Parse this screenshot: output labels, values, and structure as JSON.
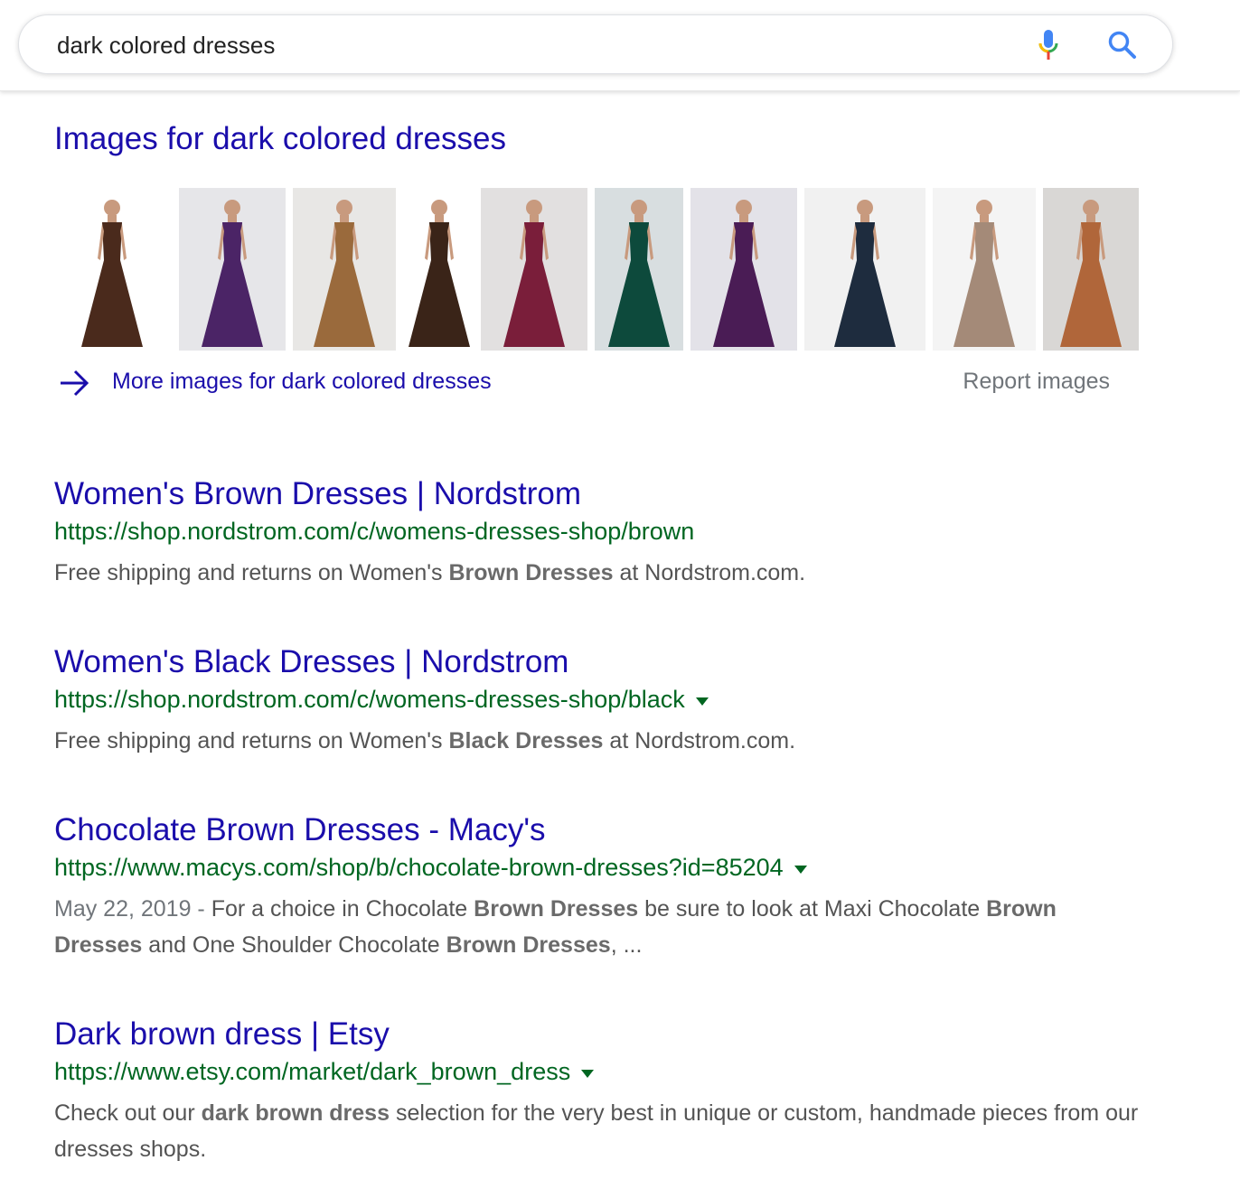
{
  "search": {
    "query": "dark colored dresses",
    "mic_icon": "mic-icon",
    "search_icon": "search-icon"
  },
  "images_block": {
    "heading": "Images for dark colored dresses",
    "thumbnails": [
      {
        "name": "brown halter gown",
        "dress_color": "#4a2a1c"
      },
      {
        "name": "purple ball gown",
        "dress_color": "#4b2466"
      },
      {
        "name": "bronze satin gown",
        "dress_color": "#9a6a3c"
      },
      {
        "name": "dark brown draped gown",
        "dress_color": "#3a2418"
      },
      {
        "name": "burgundy gown",
        "dress_color": "#7a1e3a"
      },
      {
        "name": "emerald slit gown",
        "dress_color": "#0d4a3c"
      },
      {
        "name": "purple satin gown",
        "dress_color": "#4a1c55"
      },
      {
        "name": "navy short dress",
        "dress_color": "#1e2c3e"
      },
      {
        "name": "taupe mermaid gown",
        "dress_color": "#a48a78"
      },
      {
        "name": "rust printed gown",
        "dress_color": "#b0663a"
      }
    ],
    "more_link": "More images for dark colored dresses",
    "report_link": "Report images"
  },
  "results": [
    {
      "title": "Women's Brown Dresses | Nordstrom",
      "url": "https://shop.nordstrom.com/c/womens-dresses-shop/brown",
      "has_caret": false,
      "date": "",
      "snippet_parts": [
        {
          "text": "Free shipping and returns on Women's ",
          "bold": false
        },
        {
          "text": "Brown Dresses",
          "bold": true
        },
        {
          "text": " at Nordstrom.com.",
          "bold": false
        }
      ]
    },
    {
      "title": "Women's Black Dresses | Nordstrom",
      "url": "https://shop.nordstrom.com/c/womens-dresses-shop/black",
      "has_caret": true,
      "date": "",
      "snippet_parts": [
        {
          "text": "Free shipping and returns on Women's ",
          "bold": false
        },
        {
          "text": "Black Dresses",
          "bold": true
        },
        {
          "text": " at Nordstrom.com.",
          "bold": false
        }
      ]
    },
    {
      "title": "Chocolate Brown Dresses - Macy's",
      "url": "https://www.macys.com/shop/b/chocolate-brown-dresses?id=85204",
      "has_caret": true,
      "date": "May 22, 2019 - ",
      "snippet_parts": [
        {
          "text": "For a choice in Chocolate ",
          "bold": false
        },
        {
          "text": "Brown Dresses",
          "bold": true
        },
        {
          "text": " be sure to look at Maxi Chocolate ",
          "bold": false
        },
        {
          "text": "Brown Dresses",
          "bold": true
        },
        {
          "text": " and One Shoulder Chocolate ",
          "bold": false
        },
        {
          "text": "Brown Dresses",
          "bold": true
        },
        {
          "text": ", ...",
          "bold": false
        }
      ]
    },
    {
      "title": "Dark brown dress | Etsy",
      "url": "https://www.etsy.com/market/dark_brown_dress",
      "has_caret": true,
      "date": "",
      "snippet_parts": [
        {
          "text": "Check out our ",
          "bold": false
        },
        {
          "text": "dark brown dress",
          "bold": true
        },
        {
          "text": " selection for the very best in unique or custom, handmade pieces from our dresses shops.",
          "bold": false
        }
      ]
    }
  ],
  "colors": {
    "link": "#1a0dab",
    "url": "#006621",
    "snippet": "#545454",
    "muted": "#70757a"
  }
}
